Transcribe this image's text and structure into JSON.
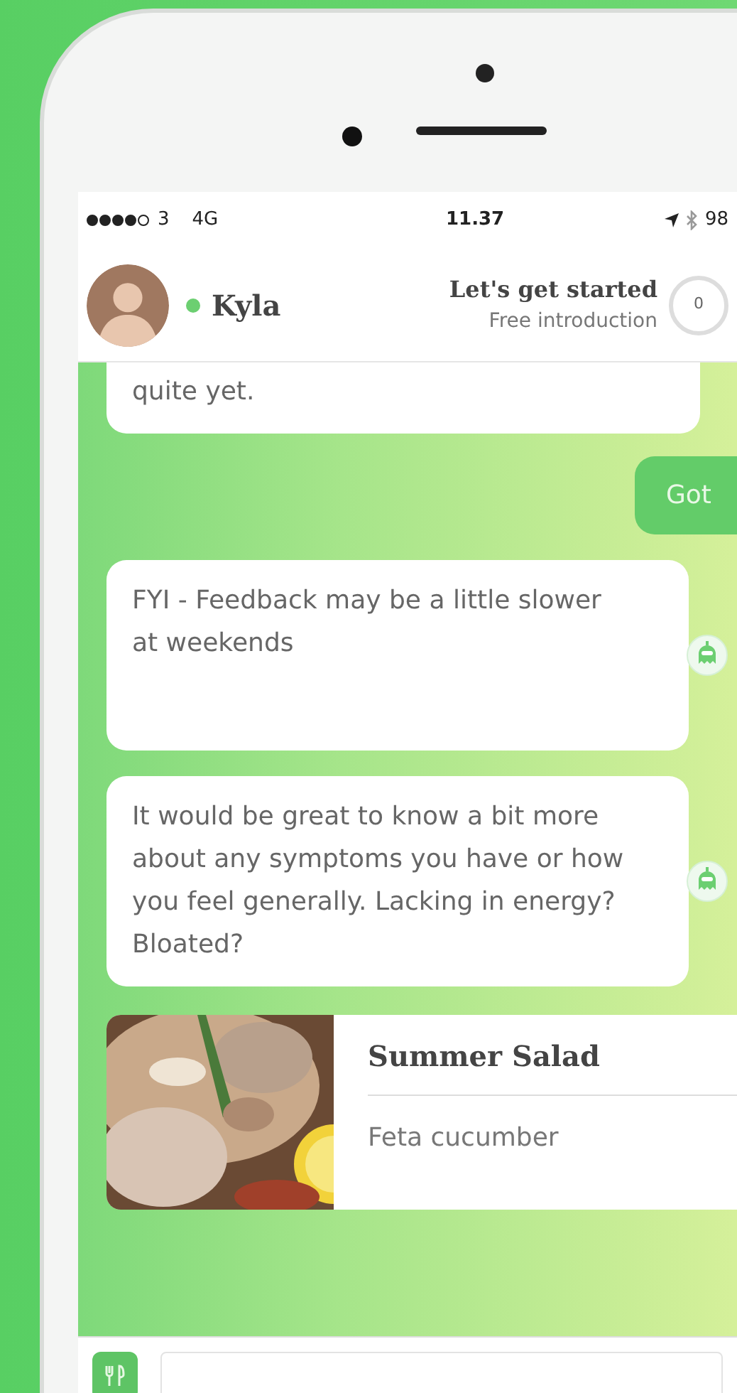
{
  "status_bar": {
    "carrier": "3",
    "network": "4G",
    "time": "11.37",
    "battery": "98"
  },
  "header": {
    "name": "Kyla",
    "online": true,
    "title": "Let's get started",
    "subtitle": "Free introduction",
    "progress": {
      "reading": "0"
    }
  },
  "messages": [
    {
      "kind": "incoming",
      "text": "quite yet.",
      "bot_icon": false,
      "cut_top": true
    },
    {
      "kind": "outgoing",
      "text": "Got"
    },
    {
      "kind": "incoming",
      "text": "FYI - Feedback may be a little slower at weekends",
      "bot_icon": true,
      "cut_top": false
    },
    {
      "kind": "incoming",
      "text": "It would be great to know a bit more about any symptoms you have or how you feel generally. Lacking in energy? Bloated?",
      "bot_icon": true,
      "cut_top": false
    },
    {
      "kind": "recipe",
      "title": "Summer Salad",
      "subtitle": "Feta cucumber"
    }
  ]
}
